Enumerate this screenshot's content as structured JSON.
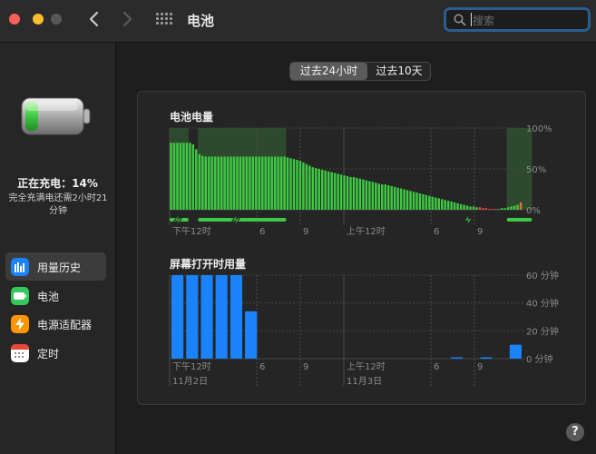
{
  "window": {
    "title": "电池",
    "search_placeholder": "搜索"
  },
  "sidebar": {
    "status_title": "正在充电：14%",
    "status_subtitle": "完全充满电还需2小时21分钟",
    "items": [
      {
        "label": "用量历史",
        "icon": "bar-chart-icon",
        "icon_color": "#1a82fb",
        "active": true
      },
      {
        "label": "电池",
        "icon": "battery-icon",
        "icon_color": "#34c759",
        "active": false
      },
      {
        "label": "电源适配器",
        "icon": "lightning-icon",
        "icon_color": "#ff9500",
        "active": false
      },
      {
        "label": "定时",
        "icon": "calendar-icon",
        "icon_color": "#ffffff",
        "active": false
      }
    ]
  },
  "tabs": {
    "active": "过去24小时",
    "inactive": "过去10天"
  },
  "colors": {
    "battery_green": "#3ec843",
    "battery_red": "#e8483e",
    "charging_shade": "#2e4a2e",
    "screen_blue": "#1a82fb",
    "accent": "#2a5e8f"
  },
  "battery_chart": {
    "title": "电池电量",
    "y_ticks": [
      "100%",
      "50%",
      "0%"
    ],
    "x_ticks": [
      "下午12时",
      "6",
      "9",
      "上午12时",
      "6",
      "9"
    ],
    "charging_icons": [
      "charging-bolt-icon",
      "charging-bolt-icon",
      "charging-bolt-icon"
    ]
  },
  "screen_chart": {
    "title": "屏幕打开时用量",
    "y_ticks": [
      "60 分钟",
      "40 分钟",
      "20 分钟",
      "0 分钟"
    ],
    "x_ticks": [
      "下午12时",
      "6",
      "9",
      "上午12时",
      "6",
      "9"
    ],
    "dates": [
      "11月2日",
      "11月3日"
    ]
  },
  "chart_data": [
    {
      "type": "bar",
      "title": "电池电量",
      "ylim": [
        0,
        100
      ],
      "unit": "%",
      "x_ticks": [
        "下午12时",
        "6",
        "9",
        "上午12时",
        "6",
        "9"
      ],
      "series": [
        {
          "values": [
            82,
            82,
            82,
            82,
            82,
            82,
            82,
            80,
            74,
            68,
            66,
            65,
            65,
            65,
            65,
            65,
            65,
            65,
            65,
            65,
            65,
            65,
            65,
            65,
            65,
            65,
            65,
            65,
            65,
            65,
            65,
            65,
            65,
            65,
            65,
            65,
            65,
            64,
            63,
            62,
            61,
            60,
            58,
            56,
            54,
            52,
            51,
            50,
            49,
            48,
            47,
            46,
            45,
            44,
            43,
            42,
            41,
            40,
            40,
            39,
            38,
            37,
            36,
            35,
            34,
            33,
            32,
            31,
            31,
            30,
            29,
            28,
            27,
            26,
            25,
            24,
            23,
            22,
            21,
            20,
            19,
            18,
            17,
            16,
            15,
            14,
            13,
            12,
            11,
            10,
            9,
            8,
            7,
            6,
            5,
            4,
            4,
            3,
            3,
            2,
            2,
            1,
            1,
            1,
            1,
            2,
            2,
            3,
            4,
            5,
            6,
            9
          ]
        }
      ],
      "low_battery_from_index": 98,
      "charging_periods": [
        [
          0,
          6
        ],
        [
          9,
          37
        ],
        [
          107,
          115
        ]
      ]
    },
    {
      "type": "bar",
      "title": "屏幕打开时用量",
      "ylim": [
        0,
        60
      ],
      "unit": "分钟",
      "x_ticks": [
        "下午12时",
        "6",
        "9",
        "上午12时",
        "6",
        "9"
      ],
      "series": [
        {
          "values": [
            60,
            60,
            60,
            60,
            60,
            34,
            0,
            0,
            0,
            0,
            0,
            0,
            0,
            0,
            0,
            0,
            0,
            0,
            0,
            1,
            0,
            1,
            0,
            10
          ]
        }
      ]
    }
  ]
}
